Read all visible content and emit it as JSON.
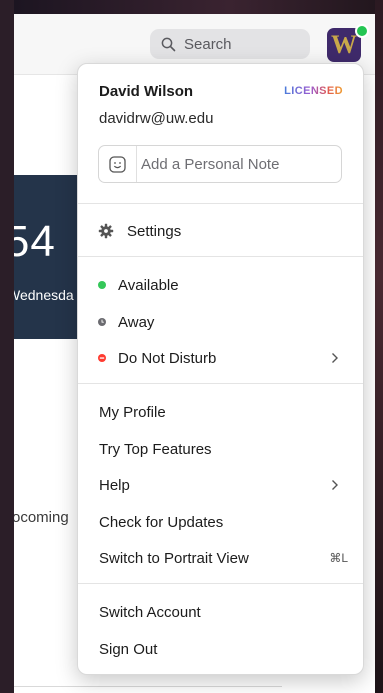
{
  "topbar": {
    "search_label": "Search",
    "avatar_letter": "W"
  },
  "background": {
    "clock_time": "):54",
    "clock_day": "Wednesda",
    "upcoming": "ocoming"
  },
  "profile": {
    "name": "David Wilson",
    "license": "LICENSED",
    "email": "davidrw@uw.edu",
    "note_placeholder": "Add a Personal Note"
  },
  "menu": {
    "settings": "Settings",
    "status": [
      {
        "label": "Available",
        "color": "#34c759"
      },
      {
        "label": "Away",
        "color": "#6b6b70"
      },
      {
        "label": "Do Not Disturb",
        "color": "#ff3b30"
      }
    ],
    "my_profile": "My Profile",
    "top_features": "Try Top Features",
    "help": "Help",
    "check_updates": "Check for Updates",
    "portrait": "Switch to Portrait View",
    "portrait_shortcut": "⌘L",
    "switch_account": "Switch Account",
    "sign_out": "Sign Out"
  },
  "icons": {
    "search": "search-icon",
    "gear": "gear-icon",
    "smiley": "smiley-icon",
    "chevron": "chevron-right-icon"
  }
}
